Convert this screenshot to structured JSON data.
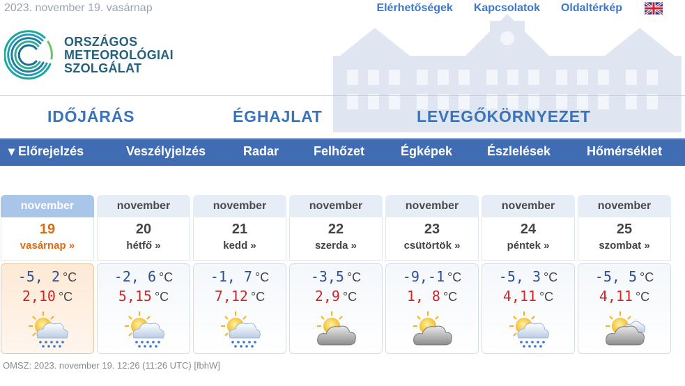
{
  "header": {
    "date": "2023. november 19. vasárnap",
    "links": [
      "Elérhetőségek",
      "Kapcsolatok",
      "Oldaltérkép"
    ],
    "logo_lines": [
      "ORSZÁGOS",
      "METEOROLÓGIAI",
      "SZOLGÁLAT"
    ]
  },
  "main_nav": [
    "IDŐJÁRÁS",
    "ÉGHAJLAT",
    "LEVEGŐKÖRNYEZET"
  ],
  "sub_nav": [
    "▾ Előrejelzés",
    "Veszélyjelzés",
    "Radar",
    "Felhőzet",
    "Égképek",
    "Észlelések",
    "Hőmérséklet"
  ],
  "forecast": [
    {
      "month": "november",
      "day": "19",
      "weekday": "vasárnap »",
      "min": "-5, 2",
      "max": "2,10",
      "unit": "°C",
      "icon": "sun-cloud-rain-icon"
    },
    {
      "month": "november",
      "day": "20",
      "weekday": "hétfő »",
      "min": "-2, 6",
      "max": "5,15",
      "unit": "°C",
      "icon": "sun-cloud-rain-icon"
    },
    {
      "month": "november",
      "day": "21",
      "weekday": "kedd »",
      "min": "-1, 7",
      "max": "7,12",
      "unit": "°C",
      "icon": "sun-cloud-rain-icon"
    },
    {
      "month": "november",
      "day": "22",
      "weekday": "szerda »",
      "min": "-3,5",
      "max": "2,9",
      "unit": "°C",
      "icon": "sun-cloud-icon"
    },
    {
      "month": "november",
      "day": "23",
      "weekday": "csütörtök »",
      "min": "-9,-1",
      "max": "1, 8",
      "unit": "°C",
      "icon": "sun-cloud-icon"
    },
    {
      "month": "november",
      "day": "24",
      "weekday": "péntek »",
      "min": "-5, 3",
      "max": "4,11",
      "unit": "°C",
      "icon": "sun-cloud-rain-icon"
    },
    {
      "month": "november",
      "day": "25",
      "weekday": "szombat »",
      "min": "-5, 5",
      "max": "4,11",
      "unit": "°C",
      "icon": "sun-clouds-icon"
    }
  ],
  "footer": "OMSZ: 2023. november 19. 12:26 (11:26  UTC)  [fbhW]",
  "colors": {
    "accent": "#3f6cb3",
    "min_temp": "#2c4f96",
    "max_temp": "#d02626",
    "active_day": "#e06a10"
  }
}
